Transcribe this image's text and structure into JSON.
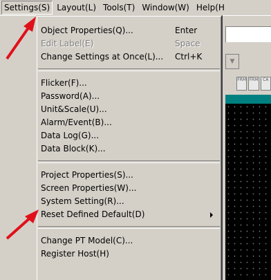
{
  "menubar": {
    "items": [
      "Settings(S)",
      "Layout(L)",
      "Tools(T)",
      "Window(W)",
      "Help(H"
    ]
  },
  "settings_menu": {
    "groups": [
      [
        {
          "label": "Object Properties(Q)...",
          "shortcut": "Enter",
          "disabled": false
        },
        {
          "label": "Edit Label(E)",
          "shortcut": "Space",
          "disabled": true
        },
        {
          "label": "Change Settings at Once(L)...",
          "shortcut": "Ctrl+K",
          "disabled": false
        }
      ],
      [
        {
          "label": "Flicker(F)...",
          "shortcut": "",
          "disabled": false
        },
        {
          "label": "Password(A)...",
          "shortcut": "",
          "disabled": false
        },
        {
          "label": "Unit&Scale(U)...",
          "shortcut": "",
          "disabled": false
        },
        {
          "label": "Alarm/Event(B)...",
          "shortcut": "",
          "disabled": false
        },
        {
          "label": "Data Log(G)...",
          "shortcut": "",
          "disabled": false
        },
        {
          "label": "Data Block(K)...",
          "shortcut": "",
          "disabled": false
        }
      ],
      [
        {
          "label": "Project Properties(S)...",
          "shortcut": "",
          "disabled": false
        },
        {
          "label": "Screen Properties(W)...",
          "shortcut": "",
          "disabled": false
        },
        {
          "label": "System Setting(R)...",
          "shortcut": "",
          "disabled": false
        },
        {
          "label": "Reset Defined Default(D)",
          "shortcut": "",
          "disabled": false,
          "submenu": true
        }
      ],
      [
        {
          "label": "Change PT Model(C)...",
          "shortcut": "",
          "disabled": false
        },
        {
          "label": "Register Host(H)",
          "shortcut": "",
          "disabled": false
        }
      ]
    ]
  },
  "toolbar": {
    "buttons": [
      "FRM",
      "FRM",
      "CA"
    ]
  },
  "annotation": {
    "color": "#e0101a"
  }
}
